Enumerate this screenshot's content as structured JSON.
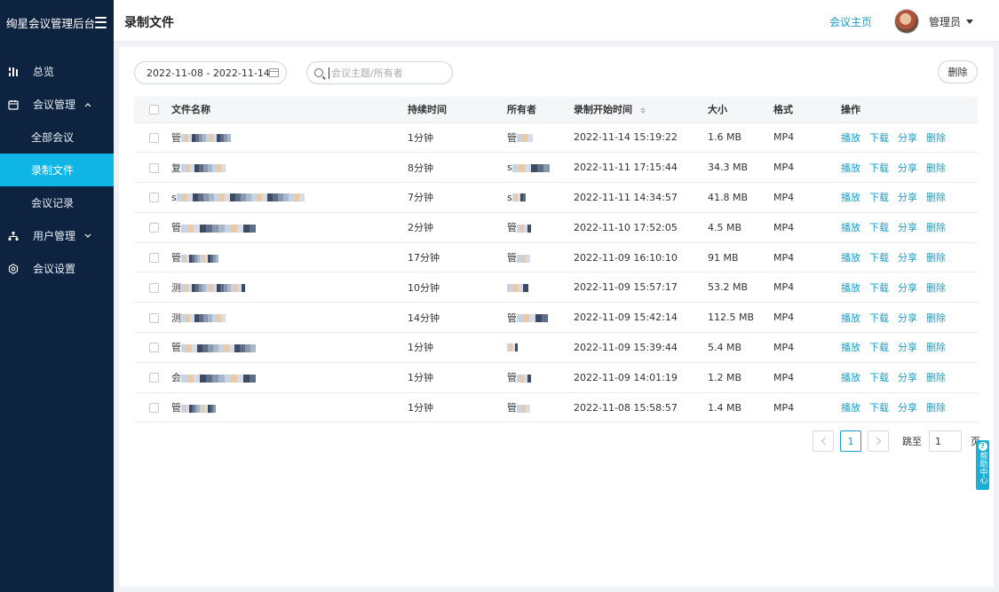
{
  "sidebar": {
    "brand": "绚星会议管理后台",
    "items": [
      {
        "label": "总览"
      },
      {
        "label": "会议管理"
      },
      {
        "label": "用户管理"
      },
      {
        "label": "会议设置"
      }
    ],
    "sub_items": [
      {
        "label": "全部会议"
      },
      {
        "label": "录制文件"
      },
      {
        "label": "会议记录"
      }
    ]
  },
  "header": {
    "title": "录制文件",
    "home_link": "会议主页",
    "user_name": "管理员"
  },
  "toolbar": {
    "date_range": "2022-11-08 - 2022-11-14",
    "search_placeholder": "会议主题/所有者",
    "search_value": "",
    "delete_label": "删除"
  },
  "table": {
    "columns": [
      "文件名称",
      "持续时间",
      "所有者",
      "录制开始时间",
      "大小",
      "格式",
      "操作"
    ],
    "actions": [
      "播放",
      "下载",
      "分享",
      "删除"
    ],
    "rows": [
      {
        "name_prefix": "管",
        "duration": "1分钟",
        "owner_prefix": "管",
        "start": "2022-11-14 15:19:22",
        "size": "1.6 MB",
        "format": "MP4"
      },
      {
        "name_prefix": "复",
        "duration": "8分钟",
        "owner_prefix": "s",
        "start": "2022-11-11 17:15:44",
        "size": "34.3 MB",
        "format": "MP4"
      },
      {
        "name_prefix": "s",
        "duration": "7分钟",
        "owner_prefix": "s",
        "start": "2022-11-11 14:34:57",
        "size": "41.8 MB",
        "format": "MP4"
      },
      {
        "name_prefix": "管",
        "duration": "2分钟",
        "owner_prefix": "管",
        "start": "2022-11-10 17:52:05",
        "size": "4.5 MB",
        "format": "MP4"
      },
      {
        "name_prefix": "管",
        "duration": "17分钟",
        "owner_prefix": "管",
        "start": "2022-11-09 16:10:10",
        "size": "91 MB",
        "format": "MP4"
      },
      {
        "name_prefix": "测",
        "duration": "10分钟",
        "owner_prefix": "",
        "start": "2022-11-09 15:57:17",
        "size": "53.2 MB",
        "format": "MP4"
      },
      {
        "name_prefix": "测",
        "duration": "14分钟",
        "owner_prefix": "管",
        "start": "2022-11-09 15:42:14",
        "size": "112.5 MB",
        "format": "MP4"
      },
      {
        "name_prefix": "管",
        "duration": "1分钟",
        "owner_prefix": "",
        "start": "2022-11-09 15:39:44",
        "size": "5.4 MB",
        "format": "MP4"
      },
      {
        "name_prefix": "会",
        "duration": "1分钟",
        "owner_prefix": "管",
        "start": "2022-11-09 14:01:19",
        "size": "1.2 MB",
        "format": "MP4"
      },
      {
        "name_prefix": "管",
        "duration": "1分钟",
        "owner_prefix": "管",
        "start": "2022-11-08 15:58:57",
        "size": "1.4 MB",
        "format": "MP4"
      }
    ]
  },
  "pagination": {
    "current_page": "1",
    "jump_label": "跳至",
    "jump_value": "1",
    "page_unit": "页"
  },
  "help": {
    "label": "帮助中心"
  },
  "colors": {
    "sidebar_bg": "#0e2340",
    "accent": "#0fb6e5",
    "link": "#1a9dc9"
  }
}
